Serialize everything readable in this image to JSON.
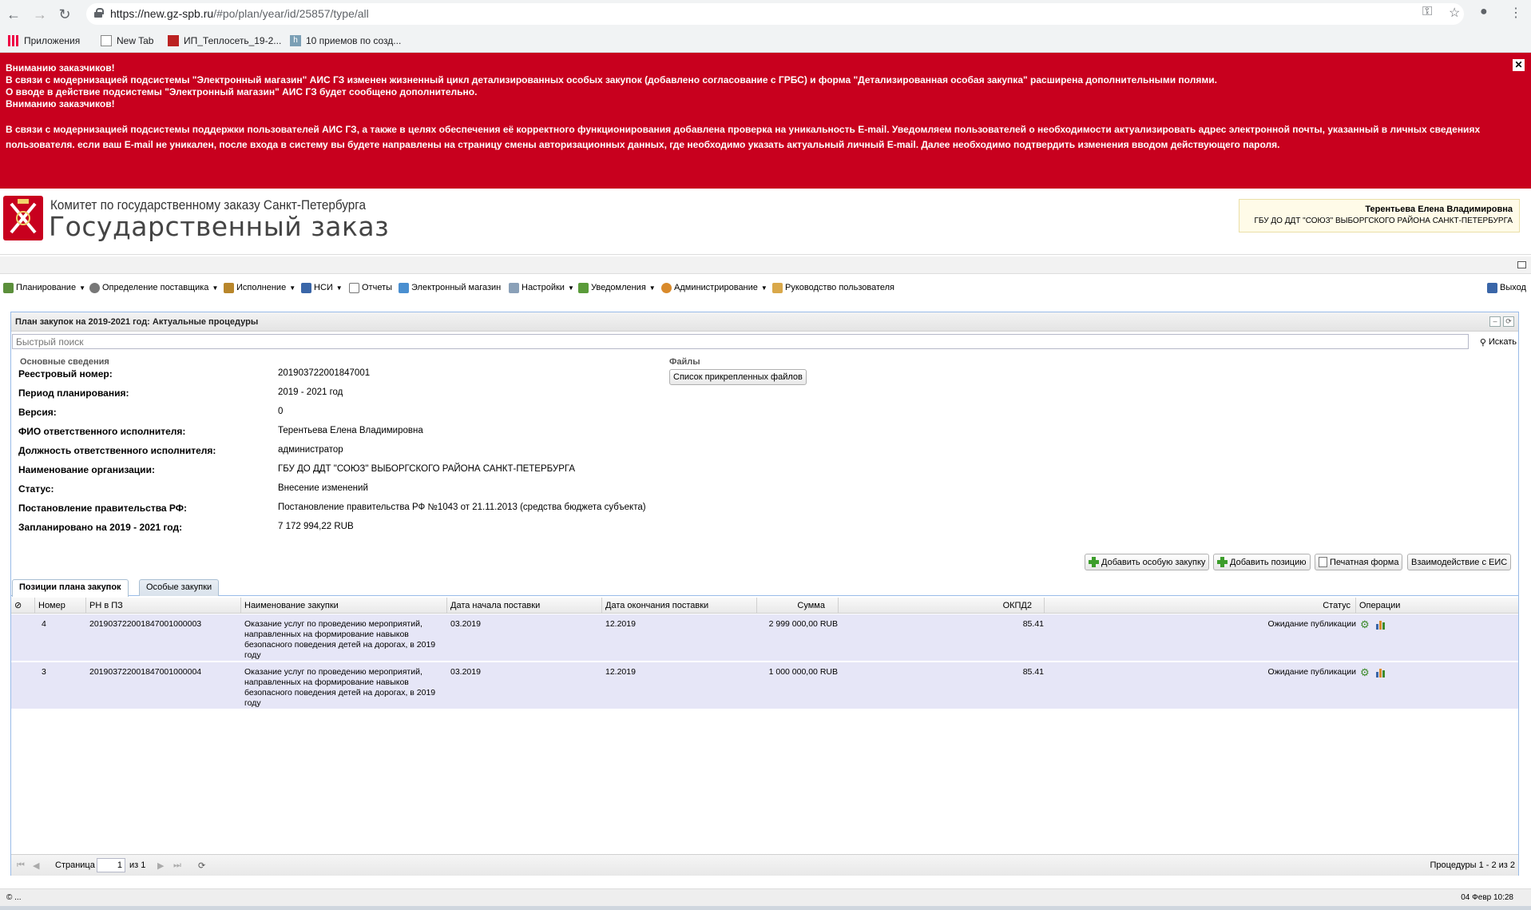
{
  "browser": {
    "url_host": "https://new.gz-spb.ru",
    "url_path": "/#po/plan/year/id/25857/type/all",
    "bookmarks": [
      "Приложения",
      "New Tab",
      "ИП_Теплосеть_19-2...",
      "10 приемов по созд..."
    ]
  },
  "alert": {
    "line1": "Вниманию заказчиков!",
    "line2": "В связи с модернизацией подсистемы \"Электронный магазин\" АИС ГЗ изменен жизненный цикл детализированных особых закупок (добавлено согласование с ГРБС) и форма \"Детализированная особая закупка\" расширена дополнительными полями.",
    "line3": "О вводе в действие подсистемы \"Электронный магазин\" АИС ГЗ будет сообщено дополнительно.",
    "line4": "Вниманию заказчиков!",
    "line5": " В связи с модернизацией подсистемы поддержки пользователей АИС ГЗ, а также в целях обеспечения её корректного функционирования добавлена проверка на уникальность E-mail. Уведомляем пользователей о необходимости актуализировать адрес электронной почты, указанный в личных сведениях пользователя. если ваш E-mail не уникален, после входа в систему вы будете направлены на страницу смены авторизационных данных, где необходимо указать актуальный личный E-mail. Далее необходимо подтвердить изменения вводом действующего пароля.",
    "close": "✕"
  },
  "header": {
    "org": "Комитет по государственному заказу Санкт-Петербурга",
    "title": "Государственный заказ",
    "user_name": "Терентьева Елена Владимировна",
    "user_org": "ГБУ ДО ДДТ \"СОЮЗ\" ВЫБОРГСКОГО РАЙОНА САНКТ-ПЕТЕРБУРГА"
  },
  "menu": {
    "items": [
      "Планирование",
      "Определение поставщика",
      "Исполнение",
      "НСИ",
      "Отчеты",
      "Электронный магазин",
      "Настройки",
      "Уведомления",
      "Администрирование",
      "Руководство пользователя"
    ],
    "exit": "Выход"
  },
  "panel": {
    "title": "План закупок на 2019-2021 год: Актуальные процедуры",
    "search_placeholder": "Быстрый поиск",
    "search_button": "Искать",
    "section_main": "Основные сведения",
    "section_files": "Файлы",
    "files_button": "Список прикрепленных файлов",
    "fields": [
      {
        "label": "Реестровый номер:",
        "value": "201903722001847001"
      },
      {
        "label": "Период планирования:",
        "value": "2019 - 2021 год"
      },
      {
        "label": "Версия:",
        "value": "0"
      },
      {
        "label": "ФИО ответственного исполнителя:",
        "value": "Терентьева Елена Владимировна"
      },
      {
        "label": "Должность ответственного исполнителя:",
        "value": "администратор"
      },
      {
        "label": "Наименование организации:",
        "value": "ГБУ ДО ДДТ \"СОЮЗ\" ВЫБОРГСКОГО РАЙОНА САНКТ-ПЕТЕРБУРГА"
      },
      {
        "label": "Статус:",
        "value": "Внесение изменений"
      },
      {
        "label": "Постановление правительства РФ:",
        "value": "Постановление правительства РФ №1043 от 21.11.2013 (средства бюджета субъекта)"
      },
      {
        "label": "Запланировано на 2019 - 2021 год:",
        "value": "7 172 994,22 RUB"
      }
    ],
    "actions": {
      "add_special": "Добавить особую закупку",
      "add_position": "Добавить позицию",
      "print_form": "Печатная форма",
      "eis": "Взаимодействие с ЕИС"
    },
    "tabs": [
      "Позиции плана закупок",
      "Особые закупки"
    ],
    "columns": [
      "Номер",
      "РН в ПЗ",
      "Наименование закупки",
      "Дата начала поставки",
      "Дата окончания поставки",
      "Сумма",
      "ОКПД2",
      "Статус",
      "Операции"
    ],
    "rows": [
      {
        "num": "4",
        "rn": "201903722001847001000003",
        "name": "Оказание услуг по проведению мероприятий, направленных на формирование навыков безопасного поведения детей на дорогах, в 2019 году",
        "start": "03.2019",
        "end": "12.2019",
        "sum": "2 999 000,00 RUB",
        "okpd": "85.41",
        "status": "Ожидание публикации"
      },
      {
        "num": "3",
        "rn": "201903722001847001000004",
        "name": "Оказание услуг по проведению мероприятий, направленных на формирование навыков безопасного поведения детей на дорогах, в 2019 году",
        "start": "03.2019",
        "end": "12.2019",
        "sum": "1 000 000,00 RUB",
        "okpd": "85.41",
        "status": "Ожидание публикации"
      }
    ],
    "pager": {
      "page_label": "Страница",
      "page_value": "1",
      "of_label": "из 1",
      "summary": "Процедуры 1 - 2 из 2"
    }
  },
  "statusbar": {
    "left": "© ...",
    "right": "04 Февр 10:28"
  },
  "colors": {
    "alert_bg": "#c8001e",
    "row_bg": "#e6e6f7",
    "panel_border": "#99bbe8"
  }
}
